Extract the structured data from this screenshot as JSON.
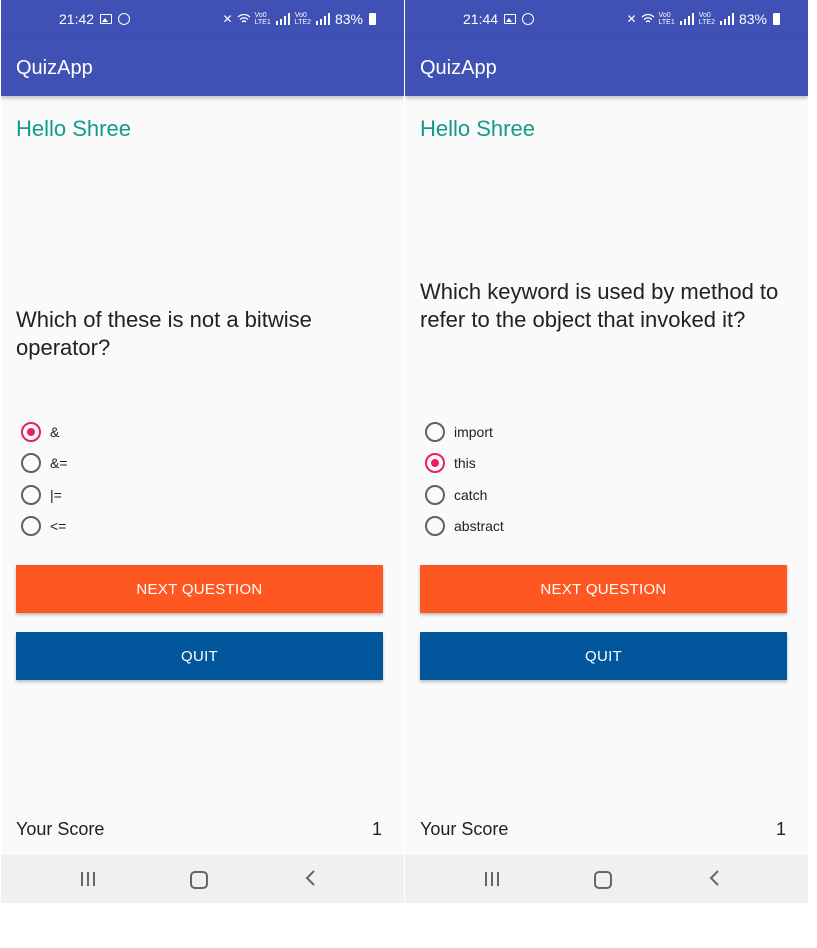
{
  "screens": [
    {
      "status": {
        "time": "21:42",
        "battery": "83%"
      },
      "app_title": "QuizApp",
      "greeting": "Hello Shree",
      "question": "Which of these is not a bitwise operator?",
      "options": [
        {
          "label": "&",
          "selected": true
        },
        {
          "label": "&=",
          "selected": false
        },
        {
          "label": "|=",
          "selected": false
        },
        {
          "label": "<=",
          "selected": false
        }
      ],
      "next_label": "NEXT QUESTION",
      "quit_label": "QUIT",
      "score_label": "Your Score",
      "score_value": "1"
    },
    {
      "status": {
        "time": "21:44",
        "battery": "83%"
      },
      "app_title": "QuizApp",
      "greeting": "Hello Shree",
      "question": "Which keyword is used by method to refer to the object that invoked it?",
      "options": [
        {
          "label": "import",
          "selected": false
        },
        {
          "label": "this",
          "selected": true
        },
        {
          "label": "catch",
          "selected": false
        },
        {
          "label": "abstract",
          "selected": false
        }
      ],
      "next_label": "NEXT QUESTION",
      "quit_label": "QUIT",
      "score_label": "Your Score",
      "score_value": "1"
    }
  ],
  "colors": {
    "primary": "#3f51b5",
    "greeting": "#129a8a",
    "accent": "#e91e63",
    "next_button": "#ff5722",
    "quit_button": "#02569b"
  },
  "icons": {
    "status_left": [
      "gallery-icon",
      "whatsapp-icon"
    ],
    "status_right": [
      "mute-icon",
      "wifi-icon",
      "volte-lte1-icon",
      "signal-icon",
      "volte-lte2-icon",
      "signal-icon",
      "battery-icon"
    ],
    "nav": [
      "recents-icon",
      "home-icon",
      "back-icon"
    ]
  }
}
